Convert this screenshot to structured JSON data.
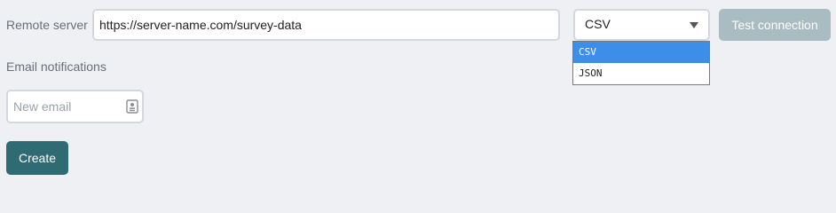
{
  "remote_server": {
    "label": "Remote server",
    "url_value": "https://server-name.com/survey-data"
  },
  "format_select": {
    "selected": "CSV",
    "options": [
      "CSV",
      "JSON"
    ],
    "highlighted_option": "CSV"
  },
  "test_connection": {
    "label": "Test connection",
    "disabled": true
  },
  "email_notifications": {
    "label": "Email notifications",
    "input_placeholder": "New email",
    "input_value": "",
    "icon": "contact-card-icon"
  },
  "create_button": {
    "label": "Create"
  },
  "colors": {
    "background": "#eef0f4",
    "primary_button": "#2e6b72",
    "disabled_button": "#a8bcc2",
    "option_highlight": "#3d8ee9",
    "label_text": "#6a6f77"
  }
}
